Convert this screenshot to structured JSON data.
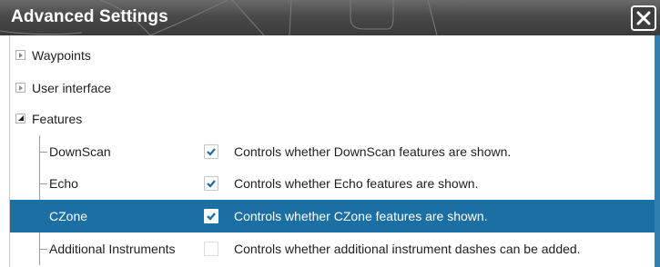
{
  "window": {
    "title": "Advanced Settings"
  },
  "tree": {
    "groups": [
      {
        "label": "Waypoints",
        "expanded": false
      },
      {
        "label": "User interface",
        "expanded": false
      },
      {
        "label": "Features",
        "expanded": true
      }
    ],
    "features": [
      {
        "label": "DownScan",
        "checked": true,
        "description": "Controls whether DownScan features are shown.",
        "selected": false
      },
      {
        "label": "Echo",
        "checked": true,
        "description": "Controls whether Echo features are shown.",
        "selected": false
      },
      {
        "label": "CZone",
        "checked": true,
        "description": "Controls whether CZone features are shown.",
        "selected": true
      },
      {
        "label": "Additional Instruments",
        "checked": false,
        "description": "Controls whether additional instrument dashes can be added.",
        "selected": false
      }
    ]
  },
  "colors": {
    "selection": "#1c6fa3",
    "check": "#1a6ea0",
    "title_bar": "#4a4a4a",
    "scrollbar": "#2f7fb0"
  }
}
